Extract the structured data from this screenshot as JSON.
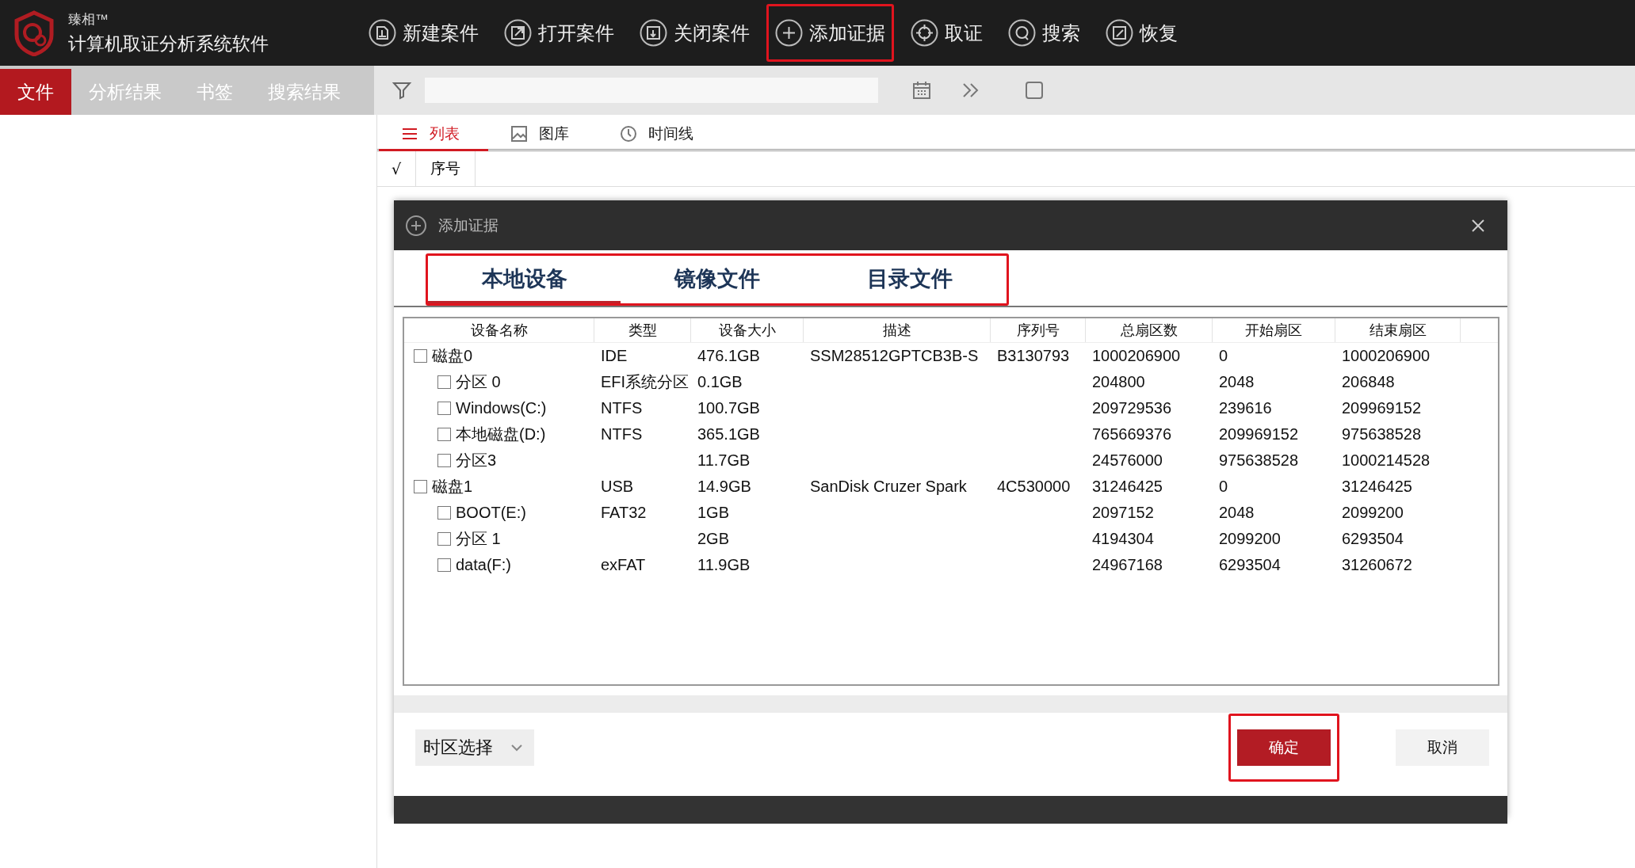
{
  "app": {
    "brand": "臻相™",
    "title": "计算机取证分析系统软件"
  },
  "toolbar": [
    {
      "label": "新建案件",
      "kind": "new",
      "highlighted": false
    },
    {
      "label": "打开案件",
      "kind": "open",
      "highlighted": false
    },
    {
      "label": "关闭案件",
      "kind": "close",
      "highlighted": false
    },
    {
      "label": "添加证据",
      "kind": "add",
      "highlighted": true
    },
    {
      "label": "取证",
      "kind": "target",
      "highlighted": false
    },
    {
      "label": "搜索",
      "kind": "search",
      "highlighted": false
    },
    {
      "label": "恢复",
      "kind": "restore",
      "highlighted": false
    }
  ],
  "nav_tabs": [
    {
      "label": "文件",
      "selected": true
    },
    {
      "label": "分析结果",
      "selected": false
    },
    {
      "label": "书签",
      "selected": false
    },
    {
      "label": "搜索结果",
      "selected": false
    }
  ],
  "view_tabs": [
    {
      "label": "列表",
      "kind": "list",
      "selected": true
    },
    {
      "label": "图库",
      "kind": "gallery",
      "selected": false
    },
    {
      "label": "时间线",
      "kind": "timeline",
      "selected": false
    }
  ],
  "list_columns": [
    "√",
    "序号"
  ],
  "dialog": {
    "title": "添加证据",
    "tabs_highlighted": true,
    "tabs": [
      {
        "label": "本地设备",
        "selected": true
      },
      {
        "label": "镜像文件",
        "selected": false
      },
      {
        "label": "目录文件",
        "selected": false
      }
    ],
    "columns": [
      "设备名称",
      "类型",
      "设备大小",
      "描述",
      "序列号",
      "总扇区数",
      "开始扇区",
      "结束扇区"
    ],
    "rows": [
      {
        "name": "磁盘0",
        "checked": false,
        "type": "IDE",
        "size": "476.1GB",
        "description": "SSM28512GPTCB3B-S",
        "serial": "B3130793",
        "total_sectors": "1000206900",
        "start_sector": "0",
        "end_sector": "1000206900",
        "children": [
          {
            "name": "分区 0",
            "checked": false,
            "type": "EFI系统分区",
            "size": "0.1GB",
            "total_sectors": "204800",
            "start_sector": "2048",
            "end_sector": "206848"
          },
          {
            "name": "Windows(C:)",
            "checked": false,
            "type": "NTFS",
            "size": "100.7GB",
            "total_sectors": "209729536",
            "start_sector": "239616",
            "end_sector": "209969152"
          },
          {
            "name": "本地磁盘(D:)",
            "checked": false,
            "type": "NTFS",
            "size": "365.1GB",
            "total_sectors": "765669376",
            "start_sector": "209969152",
            "end_sector": "975638528"
          },
          {
            "name": "分区3",
            "checked": false,
            "size": "11.7GB",
            "total_sectors": "24576000",
            "start_sector": "975638528",
            "end_sector": "1000214528"
          }
        ]
      },
      {
        "name": "磁盘1",
        "checked": false,
        "type": "USB",
        "size": "14.9GB",
        "description": "SanDisk Cruzer Spark",
        "serial": "4C530000",
        "total_sectors": "31246425",
        "start_sector": "0",
        "end_sector": "31246425",
        "children": [
          {
            "name": "BOOT(E:)",
            "checked": false,
            "type": "FAT32",
            "size": "1GB",
            "total_sectors": "2097152",
            "start_sector": "2048",
            "end_sector": "2099200"
          },
          {
            "name": "分区 1",
            "checked": false,
            "size": "2GB",
            "total_sectors": "4194304",
            "start_sector": "2099200",
            "end_sector": "6293504"
          },
          {
            "name": "data(F:)",
            "checked": false,
            "type": "exFAT",
            "size": "11.9GB",
            "total_sectors": "24967168",
            "start_sector": "6293504",
            "end_sector": "31260672"
          }
        ]
      }
    ],
    "timezone_label": "时区选择",
    "buttons": [
      {
        "label": "确定",
        "kind": "primary",
        "highlighted": true
      },
      {
        "label": "取消",
        "kind": "secondary",
        "highlighted": false
      }
    ]
  }
}
